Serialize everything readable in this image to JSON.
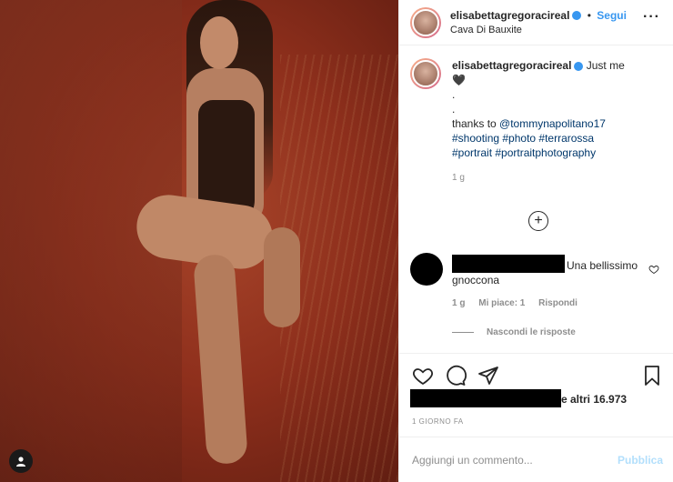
{
  "post": {
    "username": "elisabettagregoracireal",
    "follow_label": "Segui",
    "dot": "•",
    "location": "Cava Di Bauxite",
    "more_icon": "more-horizontal-icon"
  },
  "caption": {
    "username": "elisabettagregoracireal",
    "text": "Just me",
    "emoji": "🖤",
    "dot1": ".",
    "dot2": ".",
    "thanks_prefix": "thanks to ",
    "mention": "@tommynapolitano17",
    "hashtags_line1": "#shooting #photo #terrarossa",
    "hashtags_line2": "#portrait #portraitphotography",
    "age": "1 g"
  },
  "load_more_icon": "plus-circle-icon",
  "comment": {
    "text": "Una bellissimo gnoccona",
    "age": "1 g",
    "likes": "Mi piace: 1",
    "reply": "Rispondi",
    "hide_replies": "Nascondi le risposte"
  },
  "actions": {
    "icons": [
      "heart-icon",
      "comment-icon",
      "share-icon",
      "bookmark-icon"
    ]
  },
  "likes_text": "e altri 16.973",
  "date": "1 GIORNO FA",
  "add_comment": {
    "placeholder": "Aggiungi un commento...",
    "publish": "Pubblica"
  },
  "colors": {
    "accent": "#3897f0",
    "publish_disabled": "#b2dffc",
    "meta_gray": "#8e8e8e"
  }
}
